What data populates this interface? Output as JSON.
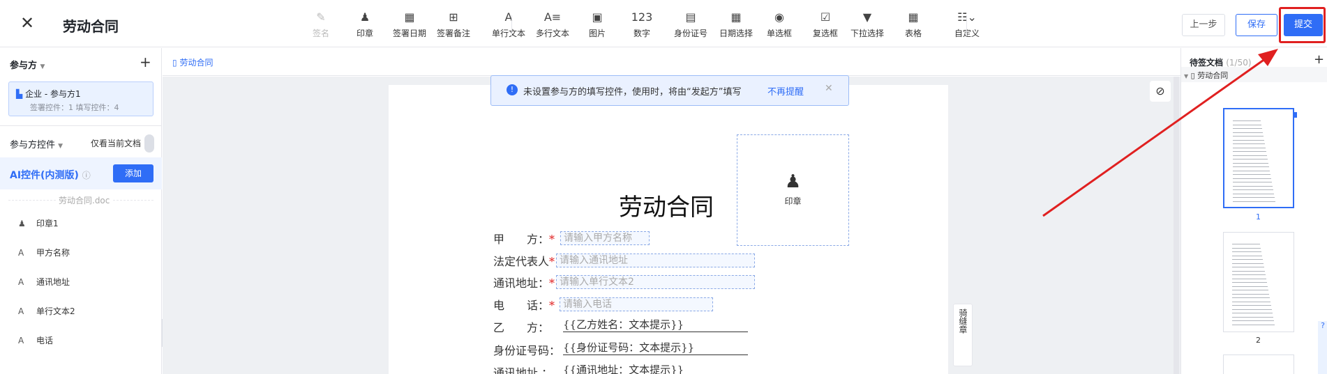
{
  "header": {
    "title": "劳动合同",
    "prev_label": "上一步",
    "save_label": "保存",
    "submit_label": "提交"
  },
  "toolbar": [
    {
      "label": "签名",
      "icon": "pen-icon",
      "glyph": "✎",
      "dim": true
    },
    {
      "label": "印章",
      "icon": "stamp-icon",
      "glyph": "♟"
    },
    {
      "label": "签署日期",
      "icon": "calendar-icon",
      "glyph": "▦"
    },
    {
      "label": "签署备注",
      "icon": "note-icon",
      "glyph": "⊞"
    },
    {
      "label": "单行文本",
      "icon": "text-icon",
      "glyph": "A"
    },
    {
      "label": "多行文本",
      "icon": "multiline-icon",
      "glyph": "A≡"
    },
    {
      "label": "图片",
      "icon": "image-icon",
      "glyph": "▣"
    },
    {
      "label": "数字",
      "icon": "number-icon",
      "glyph": "123"
    },
    {
      "label": "身份证号",
      "icon": "id-card-icon",
      "glyph": "▤"
    },
    {
      "label": "日期选择",
      "icon": "date-picker-icon",
      "glyph": "▦"
    },
    {
      "label": "单选框",
      "icon": "radio-icon",
      "glyph": "◉"
    },
    {
      "label": "复选框",
      "icon": "checkbox-icon",
      "glyph": "☑"
    },
    {
      "label": "下拉选择",
      "icon": "dropdown-icon",
      "glyph": "▼"
    },
    {
      "label": "表格",
      "icon": "table-icon",
      "glyph": "▦"
    },
    {
      "label": "自定义",
      "icon": "custom-icon",
      "glyph": "☷⌄"
    }
  ],
  "left": {
    "participants_label": "参与方",
    "add_glyph": "+",
    "party": {
      "name": "企业 - 参与方1",
      "stats": "签署控件：1    填写控件：4"
    },
    "controls_label": "参与方控件",
    "only_current_doc": "仅看当前文档",
    "ai_label": "AI控件(内测版)",
    "add_label": "添加",
    "doc_name": "劳动合同.doc",
    "items": [
      {
        "label": "印章1",
        "glyph": "♟"
      },
      {
        "label": "甲方名称",
        "glyph": "A"
      },
      {
        "label": "通讯地址",
        "glyph": "A"
      },
      {
        "label": "单行文本2",
        "glyph": "A"
      },
      {
        "label": "电话",
        "glyph": "A"
      }
    ]
  },
  "main": {
    "tab": "劳动合同",
    "notice": "未设置参与方的填写控件，使用时，将由“发起方”填写",
    "notice_link": "不再提醒",
    "seal_label": "印章",
    "contract_title": "劳动合同",
    "rows": [
      {
        "label": "甲　　方：",
        "placeholder": "请输入甲方名称"
      },
      {
        "label": "法定代表人",
        "placeholder": "请输入通讯地址"
      },
      {
        "label": "通讯地址：",
        "placeholder": "请输入单行文本2"
      },
      {
        "label": "电　　话：",
        "placeholder": "请输入电话"
      }
    ],
    "lines": [
      {
        "label": "乙　　方：",
        "value": "{{乙方姓名：文本提示}}"
      },
      {
        "label": "身份证号码：",
        "value": "{{身份证号码：文本提示}}"
      },
      {
        "label": "通讯地址 ：",
        "value": "{{通讯地址：文本提示}}"
      }
    ],
    "seam_seal": "骑缝章"
  },
  "right": {
    "title": "待签文档",
    "count": "(1/50)",
    "doc": "劳动合同",
    "page1": "1",
    "page2": "2"
  }
}
